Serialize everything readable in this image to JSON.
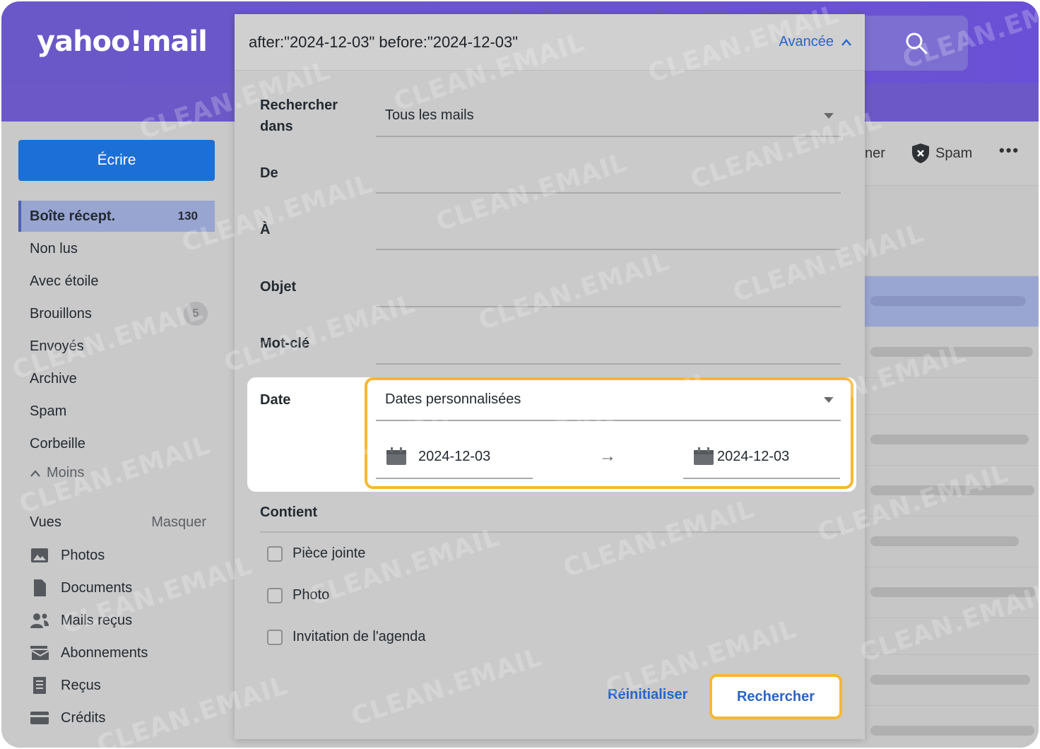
{
  "app": {
    "logo_text": "yahoo!mail"
  },
  "search": {
    "query": "after:\"2024-12-03\" before:\"2024-12-03\"",
    "advanced_label": "Avancée"
  },
  "sidebar": {
    "compose_label": "Écrire",
    "folders": [
      {
        "label": "Boîte récept.",
        "count": "130"
      },
      {
        "label": "Non lus"
      },
      {
        "label": "Avec étoile"
      },
      {
        "label": "Brouillons",
        "badge": "5"
      },
      {
        "label": "Envoyés"
      },
      {
        "label": "Archive"
      },
      {
        "label": "Spam"
      },
      {
        "label": "Corbeille"
      }
    ],
    "less_label": "Moins",
    "views_label": "Vues",
    "hide_label": "Masquer",
    "views": [
      {
        "label": "Photos",
        "icon": "photos-icon"
      },
      {
        "label": "Documents",
        "icon": "documents-icon"
      },
      {
        "label": "Mails reçus",
        "icon": "people-icon"
      },
      {
        "label": "Abonnements",
        "icon": "subscriptions-icon"
      },
      {
        "label": "Reçus",
        "icon": "receipt-icon"
      },
      {
        "label": "Crédits",
        "icon": "card-icon"
      }
    ]
  },
  "toolbar": {
    "partial_label": "ner",
    "spam_label": "Spam",
    "more_label": "•••"
  },
  "form": {
    "search_in_label_line1": "Rechercher",
    "search_in_label_line2": "dans",
    "search_in_value": "Tous les mails",
    "from_label": "De",
    "to_label": "À",
    "subject_label": "Objet",
    "keyword_label": "Mot-clé",
    "date_label": "Date",
    "date_value": "Dates personnalisées",
    "date_start": "2024-12-03",
    "date_end": "2024-12-03",
    "contains_label": "Contient",
    "checkboxes": [
      {
        "label": "Pièce jointe",
        "checked": false
      },
      {
        "label": "Photo",
        "checked": false
      },
      {
        "label": "Invitation de l'agenda",
        "checked": false
      }
    ],
    "reset_label": "Réinitialiser",
    "search_label": "Rechercher"
  },
  "watermark": "CLEAN.EMAIL",
  "colors": {
    "brand": "#6c59c7",
    "compose": "#1b6fd6",
    "link": "#2a64c8",
    "highlight": "#f7b731"
  }
}
